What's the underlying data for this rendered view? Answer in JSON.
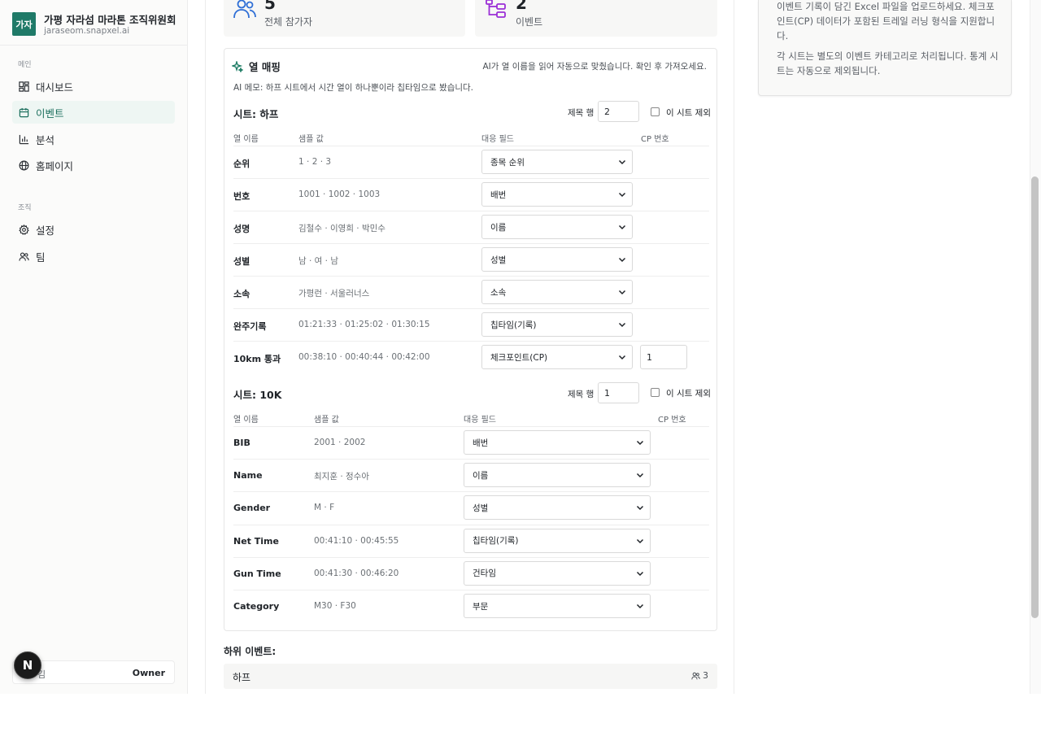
{
  "org": {
    "logo_text": "가자",
    "name": "가평 자라섬 마라톤 조직위원회",
    "domain": "jaraseom.snapxel.ai"
  },
  "sidebar": {
    "section_main": "메인",
    "section_org": "조직",
    "items": [
      {
        "label": "대시보드",
        "icon": "dashboard-icon"
      },
      {
        "label": "이벤트",
        "icon": "calendar-icon",
        "active": true
      },
      {
        "label": "분석",
        "icon": "bar-chart-icon"
      },
      {
        "label": "홈페이지",
        "icon": "globe-icon"
      },
      {
        "label": "설정",
        "icon": "gear-icon"
      },
      {
        "label": "팀",
        "icon": "users-icon"
      }
    ],
    "user_initial": "김",
    "user_role": "Owner",
    "badge": "N"
  },
  "stats": [
    {
      "value": "5",
      "label": "전체 참가자",
      "icon": "users-icon",
      "color": "#2f6fd6"
    },
    {
      "value": "2",
      "label": "이벤트",
      "icon": "hierarchy-icon",
      "color": "#9b2fd6"
    }
  ],
  "mapping": {
    "title": "열 매핑",
    "hint": "AI가 열 이름을 읽어 자동으로 맞췄습니다. 확인 후 가져오세요.",
    "ai_memo": "AI 메모: 하프 시트에서 시간 열이 하나뿐이라 칩타임으로 봤습니다.",
    "header_row_label": "제목 행",
    "exclude_label": "이 시트 제외",
    "col_headers": {
      "name": "열 이름",
      "sample": "샘플 값",
      "field": "대응 필드",
      "cp": "CP 번호"
    },
    "sheets": [
      {
        "title": "시트: 하프",
        "header_row": "2",
        "rows": [
          {
            "name": "순위",
            "sample": "1 · 2 · 3",
            "field": "종목 순위"
          },
          {
            "name": "번호",
            "sample": "1001 · 1002 · 1003",
            "field": "배번"
          },
          {
            "name": "성명",
            "sample": "김철수 · 이영희 · 박민수",
            "field": "이름"
          },
          {
            "name": "성별",
            "sample": "남 · 여 · 남",
            "field": "성별"
          },
          {
            "name": "소속",
            "sample": "가평런 · 서울러너스",
            "field": "소속"
          },
          {
            "name": "완주기록",
            "sample": "01:21:33 · 01:25:02 · 01:30:15",
            "field": "칩타임(기록)"
          },
          {
            "name": "10km 통과",
            "sample": "00:38:10 · 00:40:44 · 00:42:00",
            "field": "체크포인트(CP)",
            "cp": "1"
          }
        ]
      },
      {
        "title": "시트: 10K",
        "header_row": "1",
        "rows": [
          {
            "name": "BIB",
            "sample": "2001 · 2002",
            "field": "배번"
          },
          {
            "name": "Name",
            "sample": "최지훈 · 정수아",
            "field": "이름"
          },
          {
            "name": "Gender",
            "sample": "M · F",
            "field": "성별"
          },
          {
            "name": "Net Time",
            "sample": "00:41:10 · 00:45:55",
            "field": "칩타임(기록)"
          },
          {
            "name": "Gun Time",
            "sample": "00:41:30 · 00:46:20",
            "field": "건타임"
          },
          {
            "name": "Category",
            "sample": "M30 · F30",
            "field": "부문"
          }
        ]
      }
    ]
  },
  "sub_events": {
    "title": "하위 이벤트:",
    "items": [
      {
        "name": "하프",
        "count": "3"
      }
    ]
  },
  "right_panel": {
    "p1": "이벤트 기록이 담긴 Excel 파일을 업로드하세요. 체크포인트(CP) 데이터가 포함된 트레일 러닝 형식을 지원합니다.",
    "p2": "각 시트는 별도의 이벤트 카테고리로 처리됩니다. 통계 시트는 자동으로 제외됩니다."
  }
}
